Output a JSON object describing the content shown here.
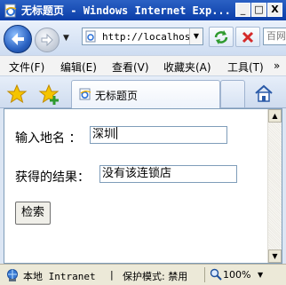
{
  "window": {
    "title_cn": "无标题页",
    "title_sep": " - ",
    "title_en": "Windows Internet Exp..."
  },
  "caption_buttons": {
    "minimize": "_",
    "maximize": "□",
    "close": "X"
  },
  "address_bar": {
    "url": "http://localhost"
  },
  "search": {
    "placeholder": "百网"
  },
  "menu": [
    {
      "label": "文件(F)"
    },
    {
      "label": "编辑(E)"
    },
    {
      "label": "查看(V)"
    },
    {
      "label": "收藏夹(A)"
    },
    {
      "label": "工具(T)"
    }
  ],
  "menu_overflow": "»",
  "tab": {
    "label": "无标题页"
  },
  "form": {
    "location_label": "输入地名 ：",
    "location_value": "深圳",
    "result_label": "获得的结果：",
    "result_value": "没有该连锁店",
    "submit_label": "检索"
  },
  "status": {
    "zone": "本地 Intranet",
    "separator": "|",
    "protected_mode": "保护模式: 禁用",
    "zoom": "100%"
  },
  "colors": {
    "title_bar": "#0a3da8",
    "content_bg": "#ffffff",
    "status_bg": "#ece9d8"
  },
  "icons": [
    "ie-page-icon",
    "back-arrow-icon",
    "forward-arrow-icon",
    "refresh-icon",
    "stop-icon",
    "favorites-star-icon",
    "add-favorites-icon",
    "home-icon",
    "intranet-globe-icon",
    "zoom-icon"
  ]
}
